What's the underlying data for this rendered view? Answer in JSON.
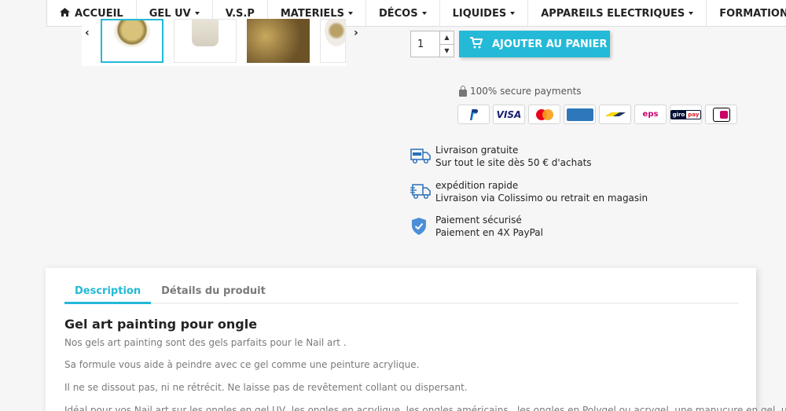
{
  "nav": {
    "items": [
      {
        "label": "ACCUEIL",
        "icon": "home-icon",
        "dropdown": false
      },
      {
        "label": "GEL UV",
        "dropdown": true
      },
      {
        "label": "V.S.P",
        "dropdown": false
      },
      {
        "label": "MATERIELS",
        "dropdown": true
      },
      {
        "label": "DÉCOS",
        "dropdown": true
      },
      {
        "label": "LIQUIDES",
        "dropdown": true
      },
      {
        "label": "APPAREILS ELECTRIQUES",
        "dropdown": true
      },
      {
        "label": "FORMATIONS",
        "dropdown": false
      }
    ]
  },
  "gallery": {
    "prev_arrow": "‹",
    "next_arrow": "›",
    "selected_index": 0
  },
  "cart": {
    "quantity": "1",
    "add_label": "AJOUTER AU PANIER",
    "accent_color": "#24b9d7"
  },
  "payments": {
    "secure_label": "100% secure payments",
    "methods": [
      "PayPal",
      "VISA",
      "Mastercard",
      "American Express",
      "Bancontact",
      "EPS",
      "giropay",
      "iDEAL"
    ]
  },
  "reassurance": [
    {
      "title": "Livraison gratuite",
      "text": "Sur tout le site dès 50 € d'achats",
      "icon": "free-shipping-truck-icon"
    },
    {
      "title": "expédition rapide",
      "text": "Livraison via Colissimo ou retrait en magasin",
      "icon": "fast-delivery-truck-icon"
    },
    {
      "title": "Paiement sécurisé",
      "text": "Paiement en 4X PayPal",
      "icon": "shield-check-icon"
    }
  ],
  "description": {
    "tabs": [
      "Description",
      "Détails du produit"
    ],
    "title": "Gel art painting pour ongle",
    "paragraphs": [
      "Nos gels art painting sont des gels parfaits pour le Nail art .",
      "Sa formule vous aide à peindre avec ce gel comme une peinture acrylique.",
      "Il ne se dissout pas, ni ne rétrécit. Ne laisse pas de revêtement collant ou dispersant.",
      "Idéal pour vos Nail art sur les ongles en gel UV, les ongles en acrylique, les ongles américains , les ongles en Polygel ou acrygel, une manucure en gel, un"
    ]
  }
}
